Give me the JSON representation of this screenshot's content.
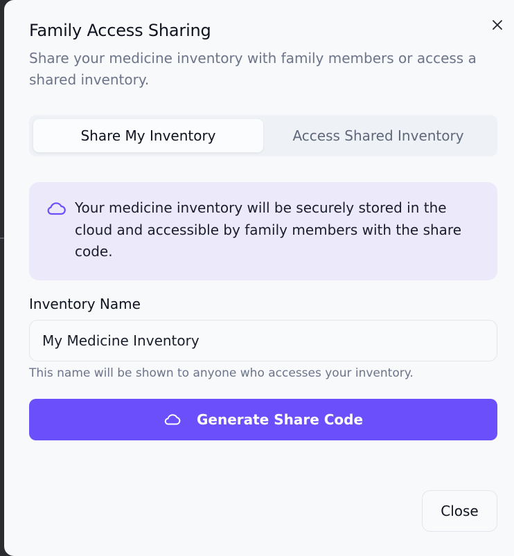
{
  "dialog": {
    "title": "Family Access Sharing",
    "subtitle": "Share your medicine inventory with family members or access a shared inventory.",
    "close_icon": "close-icon"
  },
  "tabs": [
    {
      "label": "Share My Inventory",
      "active": true
    },
    {
      "label": "Access Shared Inventory",
      "active": false
    }
  ],
  "info": {
    "icon": "cloud-icon",
    "text": "Your medicine inventory will be securely stored in the cloud and accessible by family members with the share code."
  },
  "inventory_name": {
    "label": "Inventory Name",
    "value": "My Medicine Inventory",
    "hint": "This name will be shown to anyone who accesses your inventory."
  },
  "actions": {
    "generate_label": "Generate Share Code",
    "generate_icon": "cloud-icon",
    "close_label": "Close"
  },
  "colors": {
    "accent": "#6b4ffb",
    "info_bg": "#ece9fb",
    "background": "#f8f9fb"
  }
}
